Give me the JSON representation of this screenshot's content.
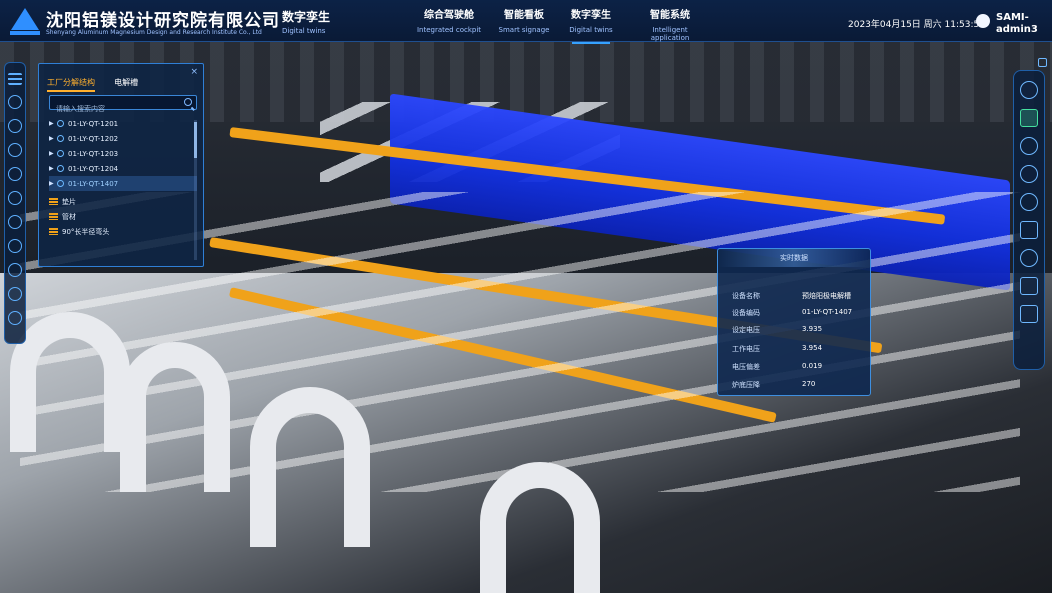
{
  "brand": {
    "title": "沈阳铝镁设计研究院有限公司",
    "subtitle": "Shenyang Aluminum Magnesium Design and Research Institute Co., Ltd"
  },
  "module": {
    "title": "数字孪生",
    "subtitle": "Digital twins"
  },
  "nav": [
    {
      "title": "综合驾驶舱",
      "subtitle": "Integrated cockpit"
    },
    {
      "title": "智能看板",
      "subtitle": "Smart signage"
    },
    {
      "title": "数字孪生",
      "subtitle": "Digital twins"
    },
    {
      "title": "智能系统",
      "subtitle": "Intelligent application"
    }
  ],
  "header": {
    "datetime": "2023年04月15日 周六 11:53:51",
    "username": "SAMI-admin3"
  },
  "tree_panel": {
    "tabs": [
      "工厂分解结构",
      "电解槽"
    ],
    "active_tab": "工厂分解结构",
    "search_placeholder": "请输入搜索内容",
    "close": "×",
    "nodes": [
      {
        "label": "01-LY-QT-1201",
        "kind": "device"
      },
      {
        "label": "01-LY-QT-1202",
        "kind": "device"
      },
      {
        "label": "01-LY-QT-1203",
        "kind": "device"
      },
      {
        "label": "01-LY-QT-1204",
        "kind": "device"
      },
      {
        "label": "01-LY-QT-1407",
        "kind": "device",
        "selected": true
      },
      {
        "label": "垫片",
        "kind": "folder"
      },
      {
        "label": "管材",
        "kind": "folder"
      },
      {
        "label": "90°长半径弯头",
        "kind": "folder"
      }
    ]
  },
  "realtime": {
    "title": "实时数据",
    "rows": [
      {
        "key": "设备名称",
        "value": "预焙阳极电解槽"
      },
      {
        "key": "设备编码",
        "value": "01-LY-QT-1407"
      },
      {
        "key": "设定电压",
        "value": "3.935"
      },
      {
        "key": "工作电压",
        "value": "3.954"
      },
      {
        "key": "电压偏差",
        "value": "0.019"
      },
      {
        "key": "炉底压降",
        "value": "270"
      }
    ]
  },
  "icons": {
    "left_rail": [
      "menu-icon",
      "target-icon",
      "wave-icon",
      "pie-icon",
      "robot-icon",
      "grid-icon",
      "refresh-icon",
      "list-icon",
      "alarm-icon",
      "search-icon",
      "user-icon"
    ],
    "right_rail": [
      "monitor-icon",
      "chat-icon",
      "location-icon",
      "recycle-icon",
      "gear-icon",
      "mail-icon",
      "person-icon",
      "building-icon",
      "door-icon"
    ]
  },
  "colors": {
    "accent": "#36a2ff",
    "tab_active": "#ffb02e",
    "selected_cell": "#1230e0",
    "busbar": "#f0a21a"
  }
}
